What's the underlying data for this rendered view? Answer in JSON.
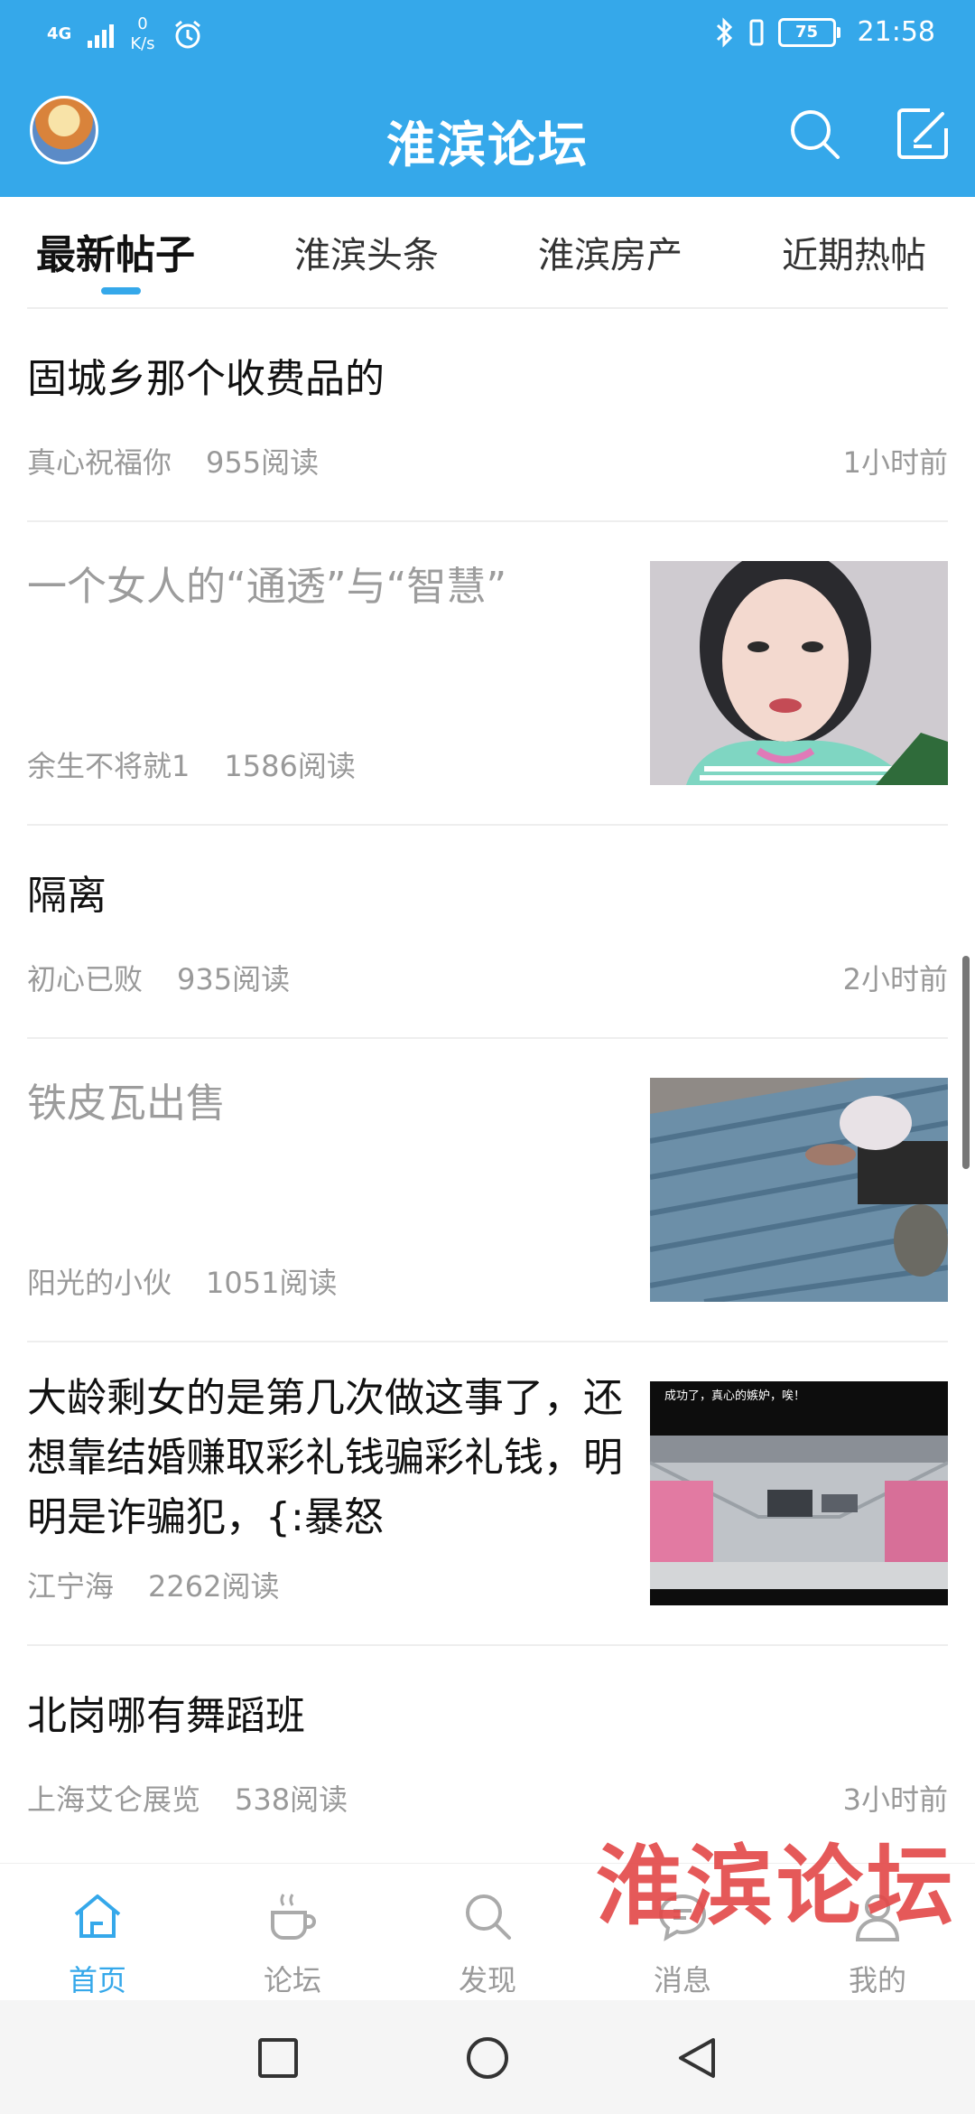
{
  "status_bar": {
    "network": "4G",
    "speed_value": "0",
    "speed_unit": "K/s",
    "battery": "75",
    "time": "21:58"
  },
  "header": {
    "title": "淮滨论坛"
  },
  "tabs": [
    {
      "label": "最新帖子",
      "active": true
    },
    {
      "label": "淮滨头条",
      "active": false
    },
    {
      "label": "淮滨房产",
      "active": false
    },
    {
      "label": "近期热帖",
      "active": false
    }
  ],
  "posts": [
    {
      "title": "固城乡那个收费品的",
      "author": "真心祝福你",
      "reads": "955阅读",
      "time": "1小时前",
      "read": false
    },
    {
      "title": "一个女人的“通透”与“智慧”",
      "author": "余生不将就1",
      "reads": "1586阅读",
      "time": "",
      "read": true
    },
    {
      "title": "隔离",
      "author": "初心已败",
      "reads": "935阅读",
      "time": "2小时前",
      "read": false
    },
    {
      "title": "铁皮瓦出售",
      "author": "阳光的小伙",
      "reads": "1051阅读",
      "time": "",
      "read": true
    },
    {
      "title": "大龄剩女的是第几次做这事了，还想靠结婚赚取彩礼钱骗彩礼钱，明明是诈骗犯，{:暴怒",
      "author": "江宁海",
      "reads": "2262阅读",
      "time": "",
      "read": false
    },
    {
      "title": "北岗哪有舞蹈班",
      "author": "上海艾仑展览",
      "reads": "538阅读",
      "time": "3小时前",
      "read": false
    }
  ],
  "thumb_texts": {
    "parking_caption": "成功了，真心的嫉妒，唉！"
  },
  "watermark": "淮滨论坛",
  "bottom_nav": [
    {
      "label": "首页",
      "icon": "home-icon",
      "active": true
    },
    {
      "label": "论坛",
      "icon": "coffee-cup-icon",
      "active": false
    },
    {
      "label": "发现",
      "icon": "search-icon",
      "active": false
    },
    {
      "label": "消息",
      "icon": "chat-bubble-icon",
      "active": false
    },
    {
      "label": "我的",
      "icon": "user-icon",
      "active": false
    }
  ],
  "colors": {
    "brand": "#35a8ea",
    "muted_text": "#999999",
    "watermark": "#e34848"
  }
}
